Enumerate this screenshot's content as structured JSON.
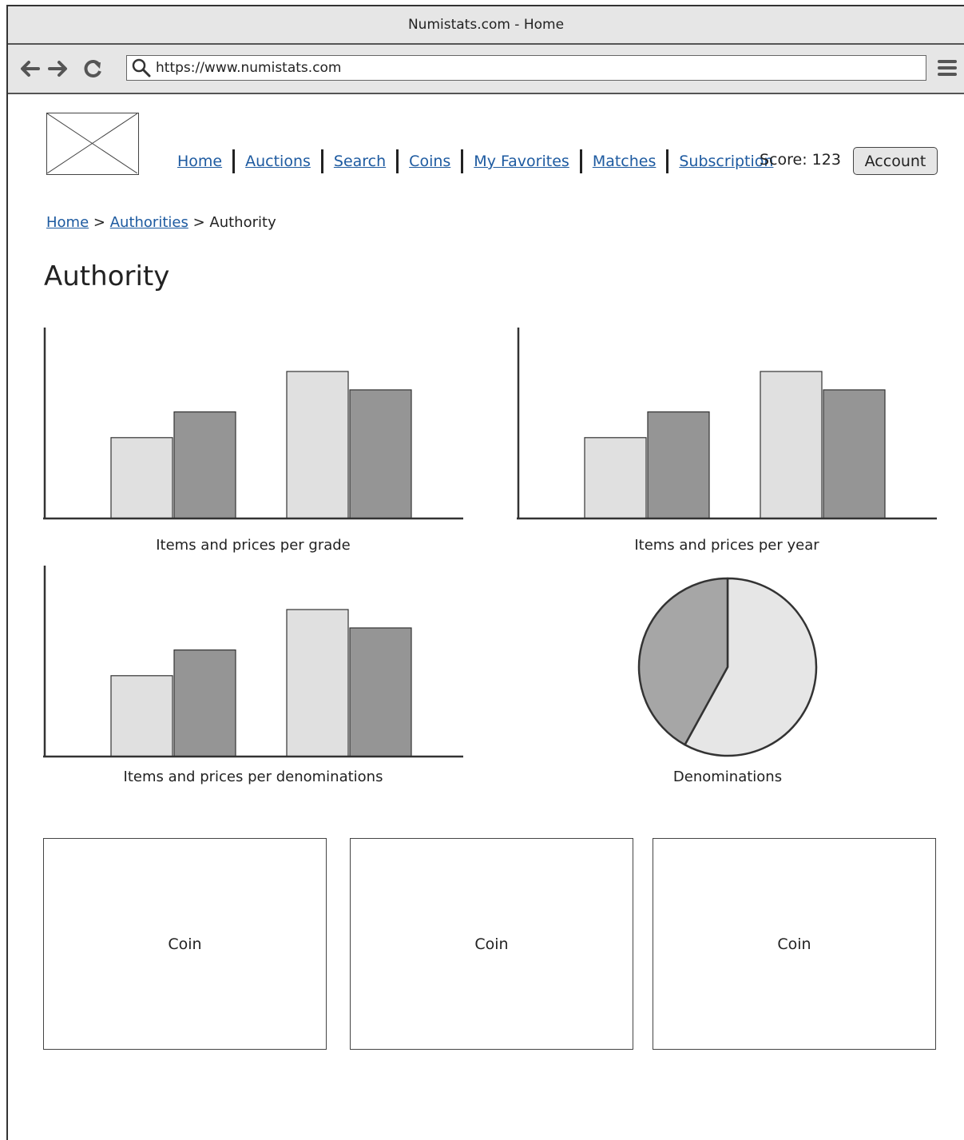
{
  "window": {
    "title": "Numistats.com - Home"
  },
  "browser": {
    "url": "https://www.numistats.com"
  },
  "icons": {
    "back": "arrow-left-icon",
    "forward": "arrow-right-icon",
    "reload": "reload-icon",
    "search": "search-icon",
    "menu": "hamburger-menu-icon",
    "logo": "image-placeholder-icon"
  },
  "nav": {
    "links": [
      "Home",
      "Auctions",
      "Search",
      "Coins",
      "My Favorites",
      "Matches",
      "Subscription"
    ],
    "score": "Score: 123",
    "account": "Account"
  },
  "breadcrumb": {
    "home": "Home",
    "sep1": ">",
    "authorities": "Authorities",
    "sep2": ">",
    "current": "Authority"
  },
  "page": {
    "title": "Authority"
  },
  "colors": {
    "series_light": "#e0e0e0",
    "series_dark": "#959595",
    "pie_light": "#e6e6e6",
    "pie_dark": "#a6a6a6"
  },
  "chart_data": [
    {
      "type": "bar",
      "title": "Items and prices per grade",
      "categories": [
        "",
        ""
      ],
      "series": [
        {
          "values": [
            44,
            80
          ]
        },
        {
          "values": [
            58,
            70
          ]
        }
      ]
    },
    {
      "type": "bar",
      "title": "Items and prices per year",
      "categories": [
        "",
        ""
      ],
      "series": [
        {
          "values": [
            44,
            80
          ]
        },
        {
          "values": [
            58,
            70
          ]
        }
      ]
    },
    {
      "type": "bar",
      "title": "Items and prices per denominations",
      "categories": [
        "",
        ""
      ],
      "series": [
        {
          "values": [
            44,
            80
          ]
        },
        {
          "values": [
            58,
            70
          ]
        }
      ]
    },
    {
      "type": "pie",
      "title": "Denominations",
      "values": [
        58,
        42
      ]
    }
  ],
  "coins": [
    "Coin",
    "Coin",
    "Coin"
  ]
}
